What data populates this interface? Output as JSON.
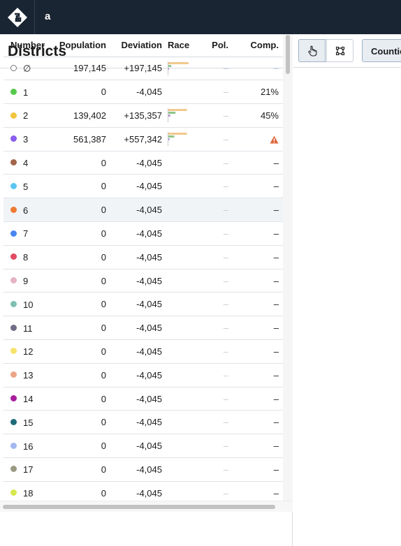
{
  "app": {
    "project_title": "a",
    "logo_icon": "districtr-logo-icon"
  },
  "sidebar": {
    "title": "Districts",
    "columns": [
      "Number",
      "Population",
      "Deviation",
      "Race",
      "Pol.",
      "Comp."
    ]
  },
  "districts": [
    {
      "number": "∅",
      "color": "",
      "population": "197,145",
      "deviation": "+197,145",
      "race": [
        0.85,
        0.12,
        0.03
      ],
      "pol": "–",
      "comp": "–",
      "comp_style": "light"
    },
    {
      "number": "1",
      "color": "#57c84d",
      "population": "0",
      "deviation": "-4,045",
      "race": null,
      "pol": "–",
      "comp": "21%",
      "comp_style": "text"
    },
    {
      "number": "2",
      "color": "#f0c53f",
      "population": "139,402",
      "deviation": "+135,357",
      "race": [
        0.78,
        0.3,
        0.08
      ],
      "pol": "–",
      "comp": "45%",
      "comp_style": "text"
    },
    {
      "number": "3",
      "color": "#8a5cf0",
      "population": "561,387",
      "deviation": "+557,342",
      "race": [
        0.78,
        0.25,
        0.05
      ],
      "pol": "–",
      "comp": "warning-icon",
      "comp_style": "icon"
    },
    {
      "number": "4",
      "color": "#a0654a",
      "population": "0",
      "deviation": "-4,045",
      "race": null,
      "pol": "–",
      "comp": "–",
      "comp_style": "dark"
    },
    {
      "number": "5",
      "color": "#5cc6f2",
      "population": "0",
      "deviation": "-4,045",
      "race": null,
      "pol": "–",
      "comp": "–",
      "comp_style": "dark"
    },
    {
      "number": "6",
      "color": "#ee7a35",
      "population": "0",
      "deviation": "-4,045",
      "race": null,
      "pol": "–",
      "comp": "–",
      "comp_style": "dark",
      "highlight": true
    },
    {
      "number": "7",
      "color": "#4a86f0",
      "population": "0",
      "deviation": "-4,045",
      "race": null,
      "pol": "–",
      "comp": "–",
      "comp_style": "dark"
    },
    {
      "number": "8",
      "color": "#e04b62",
      "population": "0",
      "deviation": "-4,045",
      "race": null,
      "pol": "–",
      "comp": "–",
      "comp_style": "dark"
    },
    {
      "number": "9",
      "color": "#e6b3c4",
      "population": "0",
      "deviation": "-4,045",
      "race": null,
      "pol": "–",
      "comp": "–",
      "comp_style": "dark"
    },
    {
      "number": "10",
      "color": "#7fbfb2",
      "population": "0",
      "deviation": "-4,045",
      "race": null,
      "pol": "–",
      "comp": "–",
      "comp_style": "dark"
    },
    {
      "number": "11",
      "color": "#716d87",
      "population": "0",
      "deviation": "-4,045",
      "race": null,
      "pol": "–",
      "comp": "–",
      "comp_style": "dark"
    },
    {
      "number": "12",
      "color": "#f7e36b",
      "population": "0",
      "deviation": "-4,045",
      "race": null,
      "pol": "–",
      "comp": "–",
      "comp_style": "dark"
    },
    {
      "number": "13",
      "color": "#eba688",
      "population": "0",
      "deviation": "-4,045",
      "race": null,
      "pol": "–",
      "comp": "–",
      "comp_style": "dark"
    },
    {
      "number": "14",
      "color": "#a61e9c",
      "population": "0",
      "deviation": "-4,045",
      "race": null,
      "pol": "–",
      "comp": "–",
      "comp_style": "dark"
    },
    {
      "number": "15",
      "color": "#1e6b78",
      "population": "0",
      "deviation": "-4,045",
      "race": null,
      "pol": "–",
      "comp": "–",
      "comp_style": "dark"
    },
    {
      "number": "16",
      "color": "#a3b8f0",
      "population": "0",
      "deviation": "-4,045",
      "race": null,
      "pol": "–",
      "comp": "–",
      "comp_style": "dark"
    },
    {
      "number": "17",
      "color": "#9a9a82",
      "population": "0",
      "deviation": "-4,045",
      "race": null,
      "pol": "–",
      "comp": "–",
      "comp_style": "dark"
    },
    {
      "number": "18",
      "color": "#d6e84f",
      "population": "0",
      "deviation": "-4,045",
      "race": null,
      "pol": "–",
      "comp": "–",
      "comp_style": "dark"
    }
  ],
  "race_colors": [
    "#f2c88c",
    "#8dc78a",
    "#b49ad8"
  ],
  "toolbar": {
    "select_tool_icon": "hand-pointer-icon",
    "rectangle_tool_icon": "rectangle-select-icon",
    "counties_label": "Counties"
  },
  "colors": {
    "topbar": "#1a2533",
    "warning": "#e0663a"
  }
}
